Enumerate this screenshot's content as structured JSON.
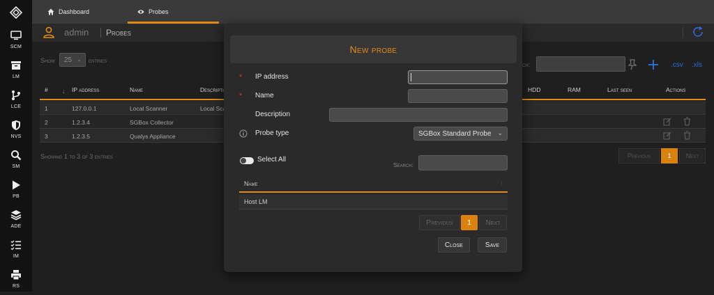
{
  "sidebar": {
    "items": [
      {
        "label": "SCM",
        "icon": "monitor-icon"
      },
      {
        "label": "LM",
        "icon": "archive-icon"
      },
      {
        "label": "LCE",
        "icon": "branch-icon"
      },
      {
        "label": "NVS",
        "icon": "shield-icon"
      },
      {
        "label": "SM",
        "icon": "search-icon"
      },
      {
        "label": "PB",
        "icon": "play-icon"
      },
      {
        "label": "ADE",
        "icon": "layers-icon"
      },
      {
        "label": "IM",
        "icon": "checklist-icon"
      },
      {
        "label": "RS",
        "icon": "printer-icon"
      }
    ]
  },
  "tabs": [
    {
      "label": "Dashboard",
      "icon": "home-icon"
    },
    {
      "label": "Probes",
      "icon": "eye-icon"
    }
  ],
  "header": {
    "user": "admin",
    "page_title": "Probes"
  },
  "list": {
    "show_label": "Show",
    "entries_value": "25",
    "entries_label": "entries",
    "search_label": "Search:",
    "export_csv": ".csv",
    "export_xls": ".xls",
    "columns": [
      "#",
      "IP address",
      "Name",
      "Description",
      "HDD",
      "RAM",
      "Last seen",
      "Actions"
    ],
    "rows": [
      {
        "num": "1",
        "ip": "127.0.0.1",
        "name": "Local Scanner",
        "desc": "Local Scanner"
      },
      {
        "num": "2",
        "ip": "1.2.3.4",
        "name": "SGBox Collector",
        "desc": ""
      },
      {
        "num": "3",
        "ip": "1.2.3.5",
        "name": "Qualys Appliance",
        "desc": ""
      }
    ],
    "info": "Showing 1 to 3 of 3 entries",
    "pagination": {
      "previous": "Previous",
      "current": "1",
      "next": "Next"
    }
  },
  "modal": {
    "title": "New probe",
    "fields": {
      "ip_label": "IP address",
      "ip_value": "",
      "name_label": "Name",
      "name_value": "",
      "description_label": "Description",
      "description_value": "",
      "probe_type_label": "Probe type",
      "probe_type_value": "SGBox Standard Probe"
    },
    "select_all_label": "Select All",
    "search_label": "Search:",
    "search_value": "",
    "table": {
      "column": "Name",
      "rows": [
        "Host LM"
      ]
    },
    "pagination": {
      "previous": "Previous",
      "current": "1",
      "next": "Next"
    },
    "close_label": "Close",
    "save_label": "Save"
  },
  "colors": {
    "accent": "#e38b16",
    "required": "#d23a2e",
    "link": "#2e6bd6"
  }
}
